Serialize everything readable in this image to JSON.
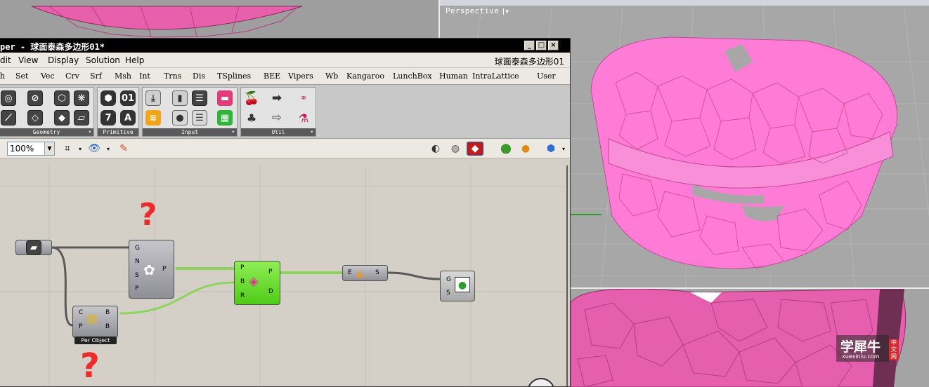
{
  "window": {
    "title": "per - 球面泰森多边形01*",
    "doc_name": "球面泰森多边形01"
  },
  "menu": [
    "dit",
    "View",
    "Display",
    "Solution",
    "Help"
  ],
  "tabs": [
    "h",
    "Set",
    "Vec",
    "Crv",
    "Srf",
    "Msh",
    "Int",
    "Trns",
    "Dis",
    "TSplines",
    "BEE",
    "Vipers",
    "Wb",
    "Kangaroo",
    "LunchBox",
    "Human",
    "IntraLattice",
    "User"
  ],
  "ribbon_panels": [
    "Geometry",
    "Primitive",
    "Input",
    "Util"
  ],
  "toolbar": {
    "zoom": "100%"
  },
  "viewport": {
    "label": "Perspective"
  },
  "components": {
    "voronoi": {
      "inputs": [
        "G",
        "N",
        "S",
        "P"
      ],
      "output": "P"
    },
    "populate": {
      "inputs": [
        "C",
        "P"
      ],
      "outputs": [
        "B",
        "B"
      ],
      "caption": "Per Object"
    },
    "brep": {
      "inputs": [
        "P",
        "B",
        "R"
      ],
      "outputs": [
        "P",
        "D"
      ]
    },
    "explode": {
      "input": "E",
      "output": "S"
    },
    "preview": {
      "inputs": [
        "G",
        "S"
      ]
    }
  },
  "annotations": {
    "question_mark": "?"
  },
  "watermark": {
    "cn": "学犀牛",
    "side": "中文网",
    "url": "xuexiniu.com"
  },
  "colors": {
    "mesh_pink": "#ff79d4",
    "component_green": "#5dd321",
    "wire_green": "#8ed35a"
  }
}
